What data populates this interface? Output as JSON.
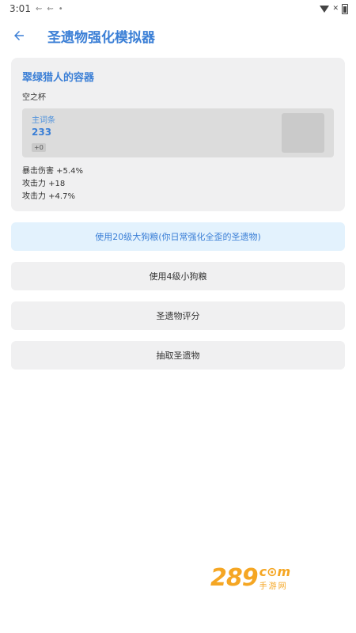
{
  "status": {
    "time": "3:01"
  },
  "header": {
    "title": "圣遗物强化模拟器"
  },
  "artifact": {
    "name": "翠绿猎人的容器",
    "slot": "空之杯",
    "main_stat_label": "主词条",
    "main_stat_value": "233",
    "level": "+0",
    "sub_stats": [
      "暴击伤害 +5.4%",
      "攻击力 +18",
      "攻击力 +4.7%"
    ]
  },
  "buttons": {
    "upgrade20": "使用20级大狗粮(你日常强化全歪的圣遗物)",
    "upgrade4": "使用4级小狗粮",
    "rate": "圣遗物评分",
    "draw": "抽取圣遗物"
  },
  "colors": {
    "accent": "#3b7fd6",
    "primary_button_bg": "#e3f2fd",
    "card_bg": "#f0f0f1",
    "watermark": "#f5a623"
  },
  "watermark": {
    "badge": "289",
    "top": "c⊙m",
    "bottom": "手游网"
  }
}
